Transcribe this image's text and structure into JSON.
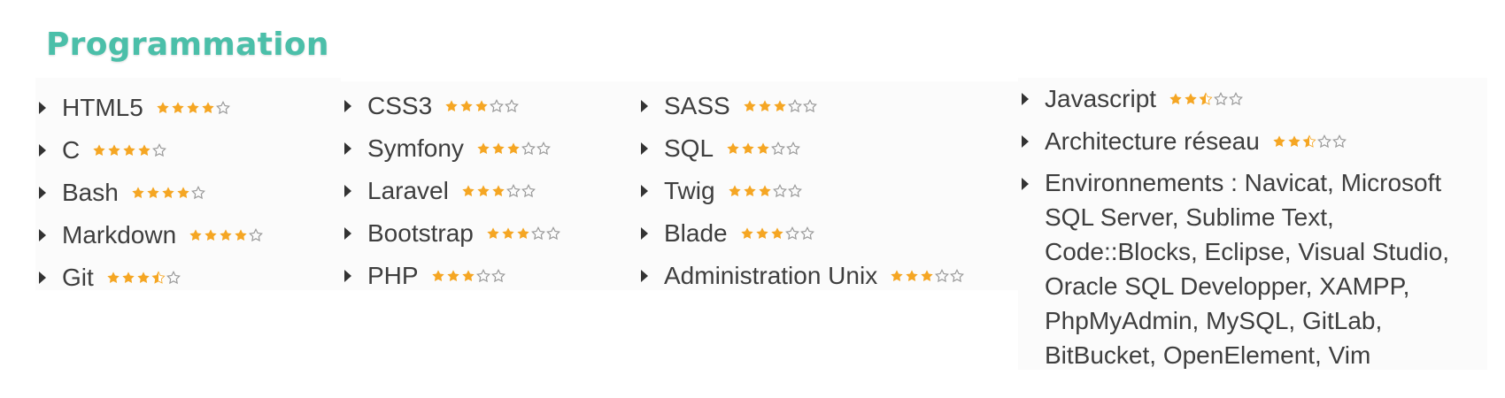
{
  "section": {
    "title": "Programmation"
  },
  "colors": {
    "title": "#4bbfa9",
    "star_filled": "#f5a623",
    "star_empty": "#9a9a9a",
    "text": "#3e3e3e"
  },
  "columns": [
    [
      {
        "label": "HTML5",
        "rating": 4,
        "max": 5
      },
      {
        "label": "C",
        "rating": 4,
        "max": 5
      },
      {
        "label": "Bash",
        "rating": 4,
        "max": 5
      },
      {
        "label": "Markdown",
        "rating": 4,
        "max": 5
      },
      {
        "label": "Git",
        "rating": 3.5,
        "max": 5
      }
    ],
    [
      {
        "label": "CSS3",
        "rating": 3,
        "max": 5
      },
      {
        "label": "Symfony",
        "rating": 3,
        "max": 5
      },
      {
        "label": "Laravel",
        "rating": 3,
        "max": 5
      },
      {
        "label": "Bootstrap",
        "rating": 3,
        "max": 5
      },
      {
        "label": "PHP",
        "rating": 3,
        "max": 5
      }
    ],
    [
      {
        "label": "SASS",
        "rating": 3,
        "max": 5
      },
      {
        "label": "SQL",
        "rating": 3,
        "max": 5
      },
      {
        "label": "Twig",
        "rating": 3,
        "max": 5
      },
      {
        "label": "Blade",
        "rating": 3,
        "max": 5
      },
      {
        "label": "Administration Unix",
        "rating": 3,
        "max": 5
      }
    ],
    [
      {
        "label": "Javascript",
        "rating": 2.5,
        "max": 5
      },
      {
        "label": "Architecture réseau",
        "rating": 2.5,
        "max": 5
      },
      {
        "label": "Environnements : Navicat, Microsoft SQL Server, Sublime Text, Code::Blocks, Eclipse, Visual Studio, Oracle SQL Developper, XAMPP, PhpMyAdmin, MySQL, GitLab, BitBucket, OpenElement, Vim"
      }
    ]
  ]
}
